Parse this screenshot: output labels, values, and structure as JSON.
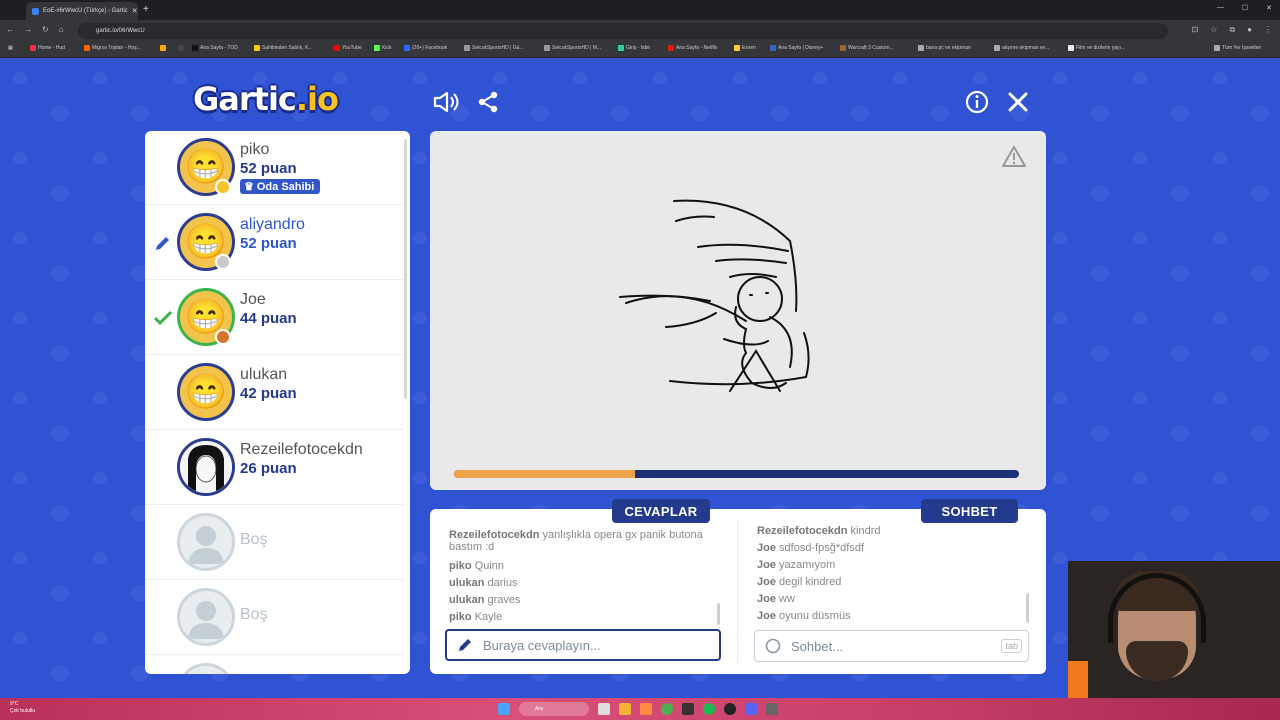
{
  "browser": {
    "tab_title": "EoE-#6rWwcU (Türkçe) - Gartic",
    "url": "gartic.io/06rWwcU",
    "bookmarks": [
      "Home - Hud",
      "Migros Toptan - Hoş...",
      "Ana Sayfa - TOD",
      "Sahibinden Satılık, K...",
      "YouTube",
      "Kick",
      "(20+) Facebook",
      "SelcukSportsHD | Gü...",
      "SelcukSportsHD | M...",
      "Giriş - Isbir",
      "Ana Sayfa - Netflix",
      "Exxen",
      "Ana Sayfa | Disney+",
      "Warcraft 3 Custom...",
      "bana pc ve ekipman",
      "alışıme ekipman ve...",
      "Film ve dizilerin yayı...",
      "Tüm Yer İşaretleri"
    ]
  },
  "logo": {
    "main": "Gartic",
    "io": ".io"
  },
  "colors": {
    "accent": "#243a8c",
    "progress": "#f0a24a",
    "drawer": "#3156c9"
  },
  "players": [
    {
      "name": "piko",
      "score": "52 puan",
      "badge": "Oda Sahibi",
      "dot": "#f3c52a",
      "state": "owner"
    },
    {
      "name": "aliyandro",
      "score": "52 puan",
      "dot": "#c9c9c9",
      "state": "drawing"
    },
    {
      "name": "Joe",
      "score": "44 puan",
      "dot": "#d5742a",
      "state": "guessed"
    },
    {
      "name": "ulukan",
      "score": "42 puan",
      "state": "normal"
    },
    {
      "name": "Rezeilefotocekdn",
      "score": "26 puan",
      "state": "normal"
    },
    {
      "name": "Boş",
      "state": "empty"
    },
    {
      "name": "Boş",
      "state": "empty"
    }
  ],
  "round": {
    "progress": 0.32
  },
  "answers": {
    "label": "CEVAPLAR",
    "messages": [
      {
        "user": "Rezeilefotocekdn",
        "text": "yanlışlıkla opera gx panik butona bastım :d"
      },
      {
        "user": "piko",
        "text": "Quinn"
      },
      {
        "user": "ulukan",
        "text": "darius"
      },
      {
        "user": "ulukan",
        "text": "graves"
      },
      {
        "user": "piko",
        "text": "Kayle"
      }
    ],
    "placeholder": "Buraya cevaplayın..."
  },
  "chat": {
    "label": "SOHBET",
    "messages": [
      {
        "user": "Rezeilefotocekdn",
        "text": "kindrd"
      },
      {
        "user": "Joe",
        "text": "sdfosd-fpsğ*dfsdf"
      },
      {
        "user": "Joe",
        "text": "yazamıyom"
      },
      {
        "user": "Joe",
        "text": "degil kindred"
      },
      {
        "user": "Joe",
        "text": "ww"
      },
      {
        "user": "Joe",
        "text": "oyunu düsmüs"
      }
    ],
    "placeholder": "Sohbet...",
    "tab_hint": "tab"
  },
  "taskbar": {
    "search": "Ara",
    "weather": "Çok bulutlu",
    "temp": "9°C"
  }
}
